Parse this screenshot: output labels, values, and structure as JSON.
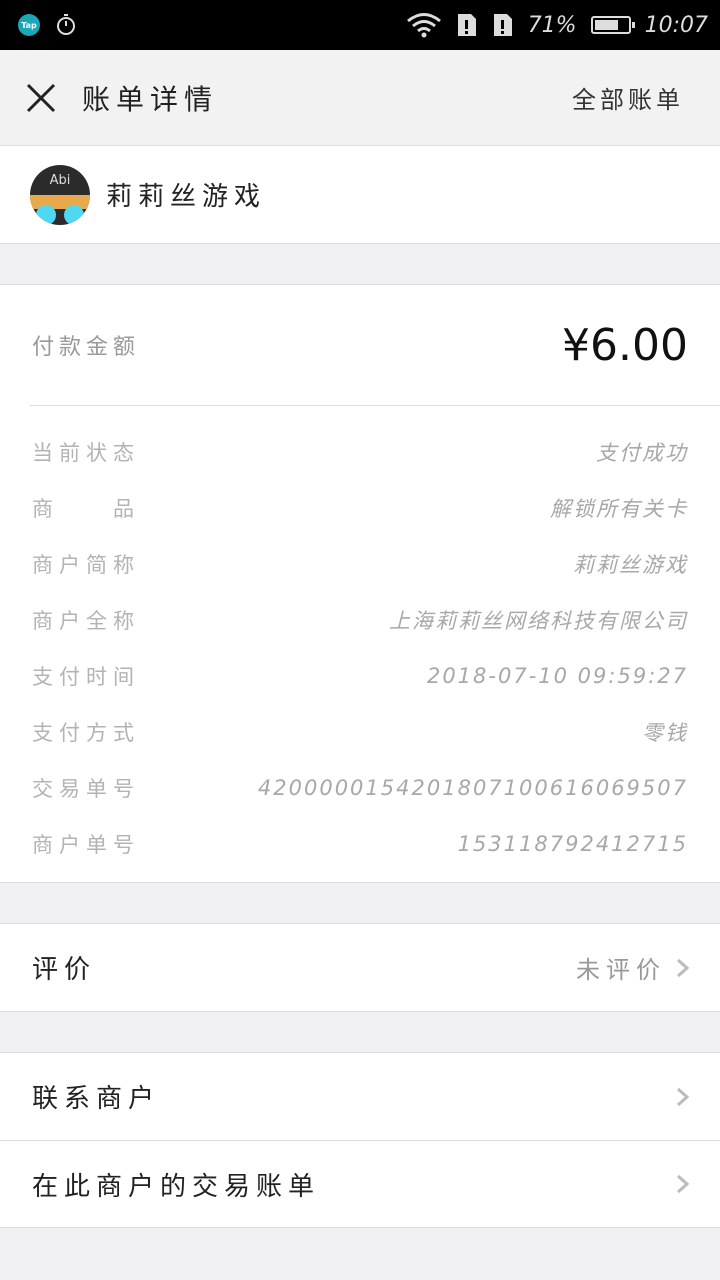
{
  "status_bar": {
    "app_icon_label": "Tap",
    "battery_percent": "71%",
    "battery_level": 0.71,
    "time": "10:07"
  },
  "header": {
    "title": "账单详情",
    "right_link": "全部账单"
  },
  "merchant": {
    "avatar_text": "Abi",
    "name": "莉莉丝游戏"
  },
  "payment": {
    "amount_label": "付款金额",
    "amount": "¥6.00"
  },
  "info_rows": [
    {
      "label": "当前状态",
      "value": "支付成功"
    },
    {
      "label": "商　　品",
      "value": "解锁所有关卡"
    },
    {
      "label": "商户简称",
      "value": "莉莉丝游戏"
    },
    {
      "label": "商户全称",
      "value": "上海莉莉丝网络科技有限公司"
    },
    {
      "label": "支付时间",
      "value": "2018-07-10 09:59:27"
    },
    {
      "label": "支付方式",
      "value": "零钱"
    },
    {
      "label": "交易单号",
      "value": "4200000154201807100616069507"
    },
    {
      "label": "商户单号",
      "value": "153118792412715"
    }
  ],
  "review": {
    "label": "评价",
    "value": "未评价"
  },
  "actions": [
    {
      "label": "联系商户"
    },
    {
      "label": "在此商户的交易账单"
    }
  ],
  "colors": {
    "status_bar_bg": "#000000",
    "header_bg": "#f2f2f2",
    "page_bg": "#efeff4",
    "label_gray": "#b3b3b3"
  }
}
